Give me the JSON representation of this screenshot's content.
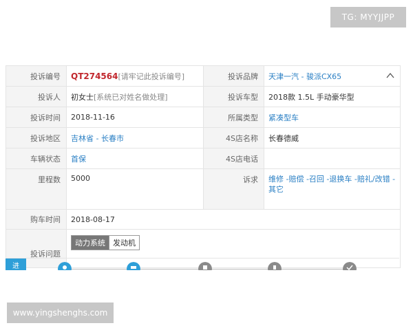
{
  "watermarks": {
    "top": "TG: MYYJJPP",
    "bottom": "www.yingshenghs.com"
  },
  "complaint": {
    "id_label": "投诉编号",
    "id_value": "QT274564",
    "id_note": "[请牢记此投诉编号]",
    "brand_label": "投诉品牌",
    "brand_value": "天津一汽 - 骏派CX65",
    "complainant_label": "投诉人",
    "complainant_value": "初女士",
    "complainant_note": "[系统已对姓名做处理]",
    "model_label": "投诉车型",
    "model_value": "2018款 1.5L 手动豪华型",
    "time_label": "投诉时间",
    "time_value": "2018-11-16",
    "type_label": "所属类型",
    "type_value": "紧凑型车",
    "region_label": "投诉地区",
    "region_value": "吉林省 - 长春市",
    "dealer_label": "4S店名称",
    "dealer_value": "长春德威",
    "status_label": "车辆状态",
    "status_value": "首保",
    "dealer_phone_label": "4S店电话",
    "dealer_phone_value": "",
    "mileage_label": "里程数",
    "mileage_value": "5000",
    "demand_label": "诉求",
    "demand_value": "维修 -赔偿 -召回 -退换车 -赔礼/改错 -其它",
    "purchase_label": "购车时间",
    "purchase_value": "2018-08-17",
    "issue_label": "投诉问题",
    "issue_tags": [
      "动力系统",
      "发动机"
    ]
  },
  "progress": {
    "tab_label": "进"
  },
  "colors": {
    "link": "#2a7fc4",
    "id_red": "#c1272d",
    "step_blue": "#2e9fd8",
    "step_grey": "#8a8a8a"
  }
}
